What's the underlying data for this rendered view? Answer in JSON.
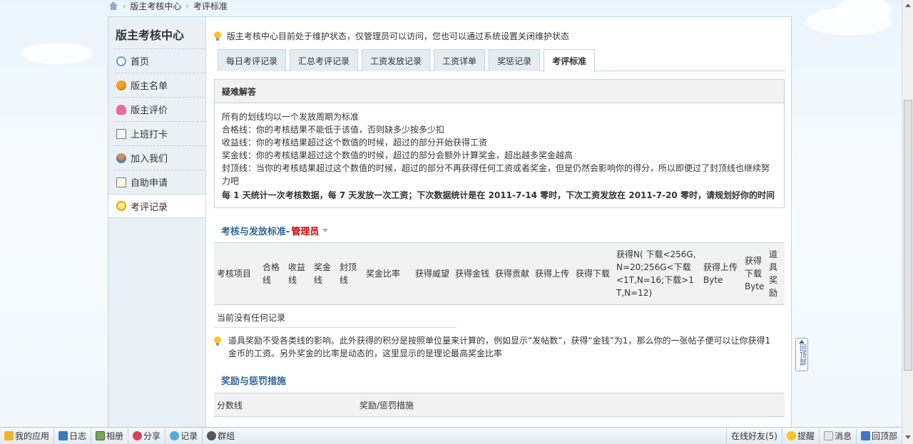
{
  "breadcrumb": {
    "items": [
      "版主考核中心",
      "考评标准"
    ]
  },
  "sidebar": {
    "title": "版主考核中心",
    "items": [
      {
        "label": "首页"
      },
      {
        "label": "版主名单"
      },
      {
        "label": "版主评价"
      },
      {
        "label": "上班打卡"
      },
      {
        "label": "加入我们"
      },
      {
        "label": "自助申请"
      },
      {
        "label": "考评记录"
      }
    ]
  },
  "notice": "版主考核中心目前处于维护状态，仅管理员可以访问，您也可以通过系统设置关闭维护状态",
  "tabs": [
    {
      "label": "每日考评记录"
    },
    {
      "label": "汇总考评记录"
    },
    {
      "label": "工资发放记录"
    },
    {
      "label": "工资详单"
    },
    {
      "label": "奖惩记录"
    },
    {
      "label": "考评标准"
    }
  ],
  "faq": {
    "title": "疑难解答",
    "lines": [
      "所有的划线均以一个发放周期为标准",
      "合格线：你的考核结果不能低于该值，否则缺多少按多少扣",
      "收益线：你的考核结果超过这个数值的时候，超过的部分开始获得工资",
      "奖金线：你的考核结果超过这个数值的时候，超过的部分会额外计算奖金，超出越多奖金越高",
      "封顶线：当你的考核结果超过这个数值的时候，超过的部分不再获得任何工资或者奖金，但是仍然会影响你的得分，所以即便过了封顶线也继续努力吧"
    ],
    "bold_line": "每 1 天统计一次考核数据，每 7 天发放一次工资；下次数据统计是在 2011-7-14 零时，下次工资发放在 2011-7-20 零时，请规划好你的时间"
  },
  "standard": {
    "title": "考核与发放标准-",
    "role": "管理员",
    "headers": [
      "考核项目",
      "合格线",
      "收益线",
      "奖金线",
      "封顶线",
      "奖金比率",
      "获得威望",
      "获得金钱",
      "获得贡献",
      "获得上传",
      "获得下载",
      "获得N( 下载<256G,N=20;256G<下载<1T,N=16;下载>1T,N=12)",
      "获得上传Byte",
      "获得下载Byte",
      "道具奖励"
    ],
    "empty": "当前没有任何记录"
  },
  "tip": "道具奖励不受各类线的影响。此外获得的积分是按照单位量来计算的，例如显示“发帖数”，获得“金钱”为1，那么你的一张帖子便可以让你获得1金币的工资。另外奖金的比率是动态的，这里显示的是理论最高奖金比率",
  "reward": {
    "title": "奖励与惩罚措施",
    "headers": [
      "分数线",
      "奖励/惩罚措施"
    ]
  },
  "backtop": "回顶部",
  "bottombar": {
    "left": [
      "我的应用",
      "日志",
      "相册",
      "分享",
      "记录",
      "群组"
    ],
    "right": [
      "在线好友(5)",
      "提醒",
      "消息",
      "回顶部"
    ]
  }
}
